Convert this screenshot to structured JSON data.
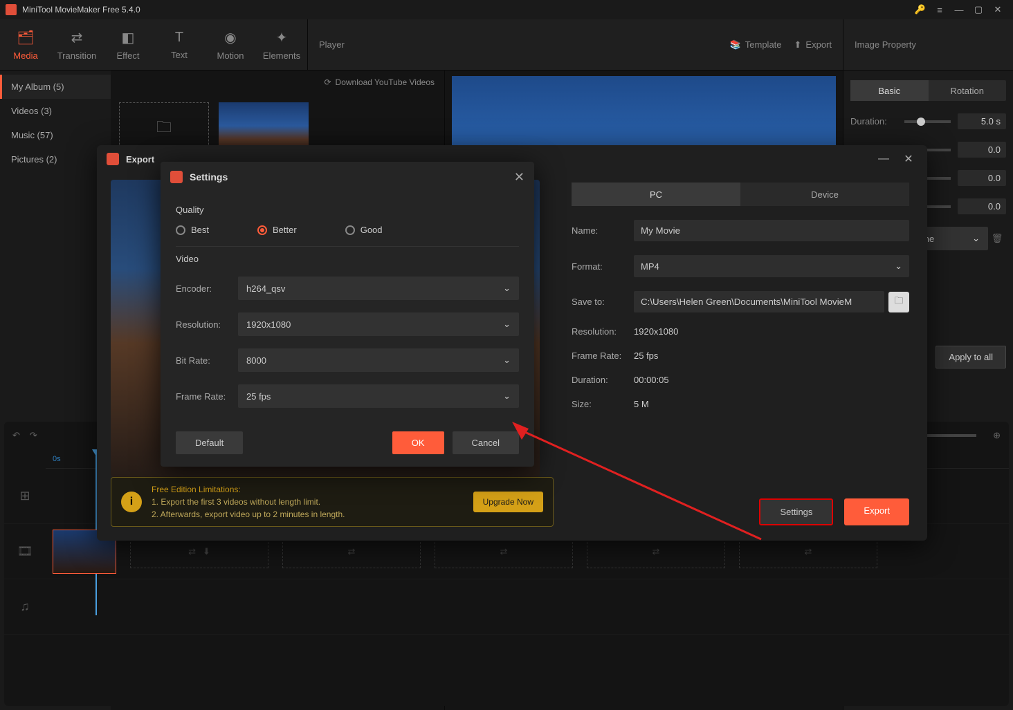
{
  "app": {
    "title": "MiniTool MovieMaker Free 5.4.0"
  },
  "toolbar": {
    "items": [
      {
        "label": "Media",
        "active": true
      },
      {
        "label": "Transition"
      },
      {
        "label": "Effect"
      },
      {
        "label": "Text"
      },
      {
        "label": "Motion"
      },
      {
        "label": "Elements"
      }
    ]
  },
  "player": {
    "label": "Player",
    "template": "Template",
    "export": "Export"
  },
  "rightpanel": {
    "header": "Image Property"
  },
  "sidebar": {
    "items": [
      {
        "label": "My Album (5)",
        "active": true
      },
      {
        "label": "Videos (3)"
      },
      {
        "label": "Music (57)"
      },
      {
        "label": "Pictures (2)"
      }
    ],
    "download_label": "Download YouTube Videos"
  },
  "props": {
    "tab_basic": "Basic",
    "tab_rotation": "Rotation",
    "duration_label": "Duration:",
    "duration_value": "5.0 s",
    "v1": "0.0",
    "v2": "0.0",
    "v3": "0.0",
    "opt_none": "one",
    "apply": "Apply to all"
  },
  "timeline": {
    "t0": "0s"
  },
  "export_dialog": {
    "title": "Export",
    "tab_pc": "PC",
    "tab_device": "Device",
    "name_label": "Name:",
    "name_value": "My Movie",
    "format_label": "Format:",
    "format_value": "MP4",
    "saveto_label": "Save to:",
    "saveto_value": "C:\\Users\\Helen Green\\Documents\\MiniTool MovieM",
    "resolution_label": "Resolution:",
    "resolution_value": "1920x1080",
    "framerate_label": "Frame Rate:",
    "framerate_value": "25 fps",
    "duration_label": "Duration:",
    "duration_value": "00:00:05",
    "size_label": "Size:",
    "size_value": "5 M",
    "settings_btn": "Settings",
    "export_btn": "Export",
    "limits_heading": "Free Edition Limitations:",
    "limits_line1": "1. Export the first 3 videos without length limit.",
    "limits_line2": "2. Afterwards, export video up to 2 minutes in length.",
    "upgrade_btn": "Upgrade Now"
  },
  "settings_dialog": {
    "title": "Settings",
    "quality_label": "Quality",
    "q_best": "Best",
    "q_better": "Better",
    "q_good": "Good",
    "video_label": "Video",
    "encoder_label": "Encoder:",
    "encoder_value": "h264_qsv",
    "resolution_label": "Resolution:",
    "resolution_value": "1920x1080",
    "bitrate_label": "Bit Rate:",
    "bitrate_value": "8000",
    "framerate_label": "Frame Rate:",
    "framerate_value": "25 fps",
    "default_btn": "Default",
    "ok_btn": "OK",
    "cancel_btn": "Cancel"
  }
}
